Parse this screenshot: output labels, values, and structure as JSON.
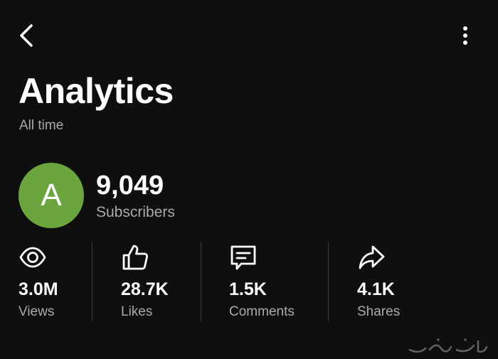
{
  "header": {
    "back_icon": "chevron-left-icon",
    "more_icon": "more-vertical-icon"
  },
  "page": {
    "title": "Analytics",
    "period": "All time"
  },
  "channel": {
    "avatar_letter": "A",
    "avatar_color": "#6aa63d",
    "subscriber_count": "9,049",
    "subscriber_label": "Subscribers"
  },
  "stats": [
    {
      "icon": "eye-icon",
      "value": "3.0M",
      "label": "Views"
    },
    {
      "icon": "thumbs-up-icon",
      "value": "28.7K",
      "label": "Likes"
    },
    {
      "icon": "comment-icon",
      "value": "1.5K",
      "label": "Comments"
    },
    {
      "icon": "share-icon",
      "value": "4.1K",
      "label": "Shares"
    }
  ],
  "colors": {
    "background": "#0f0f0f",
    "text_primary": "#ffffff",
    "text_secondary": "#aaaaaa",
    "divider": "#3a3a3a"
  }
}
